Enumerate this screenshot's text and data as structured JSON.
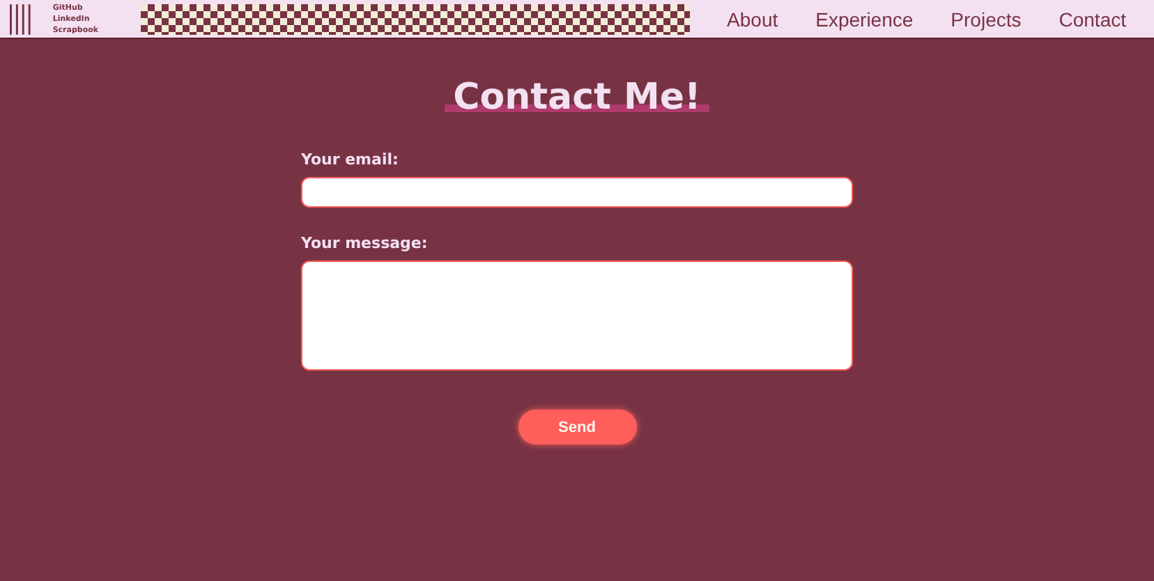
{
  "header": {
    "links": [
      "GitHub",
      "LinkedIn",
      "Scrapbook"
    ],
    "nav": [
      "About",
      "Experience",
      "Projects",
      "Contact"
    ]
  },
  "title": "Contact Me!",
  "form": {
    "fields": [
      {
        "label": "Your email:",
        "kind": "line"
      },
      {
        "label": "Your message:",
        "kind": "area"
      }
    ],
    "button": "Send"
  }
}
